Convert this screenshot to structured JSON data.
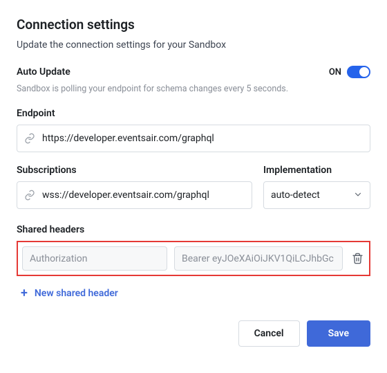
{
  "title": "Connection settings",
  "subtitle": "Update the connection settings for your Sandbox",
  "autoUpdate": {
    "label": "Auto Update",
    "stateText": "ON",
    "helper": "Sandbox is polling your endpoint for schema changes every 5 seconds."
  },
  "endpoint": {
    "label": "Endpoint",
    "value": "https://developer.eventsair.com/graphql"
  },
  "subscriptions": {
    "label": "Subscriptions",
    "value": "wss://developer.eventsair.com/graphql"
  },
  "implementation": {
    "label": "Implementation",
    "selected": "auto-detect"
  },
  "sharedHeaders": {
    "label": "Shared headers",
    "row": {
      "key": "Authorization",
      "value": "Bearer eyJOeXAiOiJKV1QiLCJhbGc"
    },
    "addLabel": "New shared header"
  },
  "buttons": {
    "cancel": "Cancel",
    "save": "Save"
  }
}
